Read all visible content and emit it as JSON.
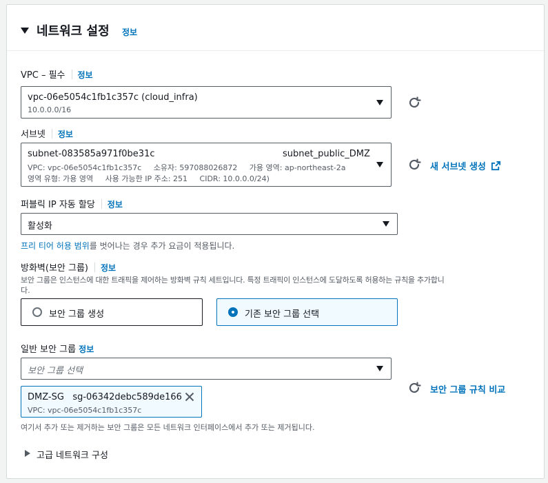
{
  "header": {
    "title": "네트워크 설정",
    "info": "정보"
  },
  "vpc": {
    "label": "VPC – 필수",
    "info": "정보",
    "value": "vpc-06e5054c1fb1c357c (cloud_infra)",
    "sub": "10.0.0.0/16"
  },
  "subnet": {
    "label": "서브넷",
    "info": "정보",
    "value": "subnet-083585a971f0be31c",
    "name": "subnet_public_DMZ",
    "line2": "VPC: vpc-06e5054c1fb1c357c     소유자: 597088026872     가용 영역: ap-northeast-2a",
    "line3": "영역 유형: 가용 영역     사용 가능한 IP 주소: 251     CIDR: 10.0.0.0/24)",
    "create_link": "새 서브넷 생성"
  },
  "public_ip": {
    "label": "퍼블릭 IP 자동 할당",
    "info": "정보",
    "value": "활성화",
    "note_link": "프리 티어 허용 범위",
    "note_rest": "를 벗어나는 경우 추가 요금이 적용됩니다."
  },
  "firewall": {
    "label": "방화벽(보안 그룹)",
    "info": "정보",
    "desc1": "보안 그룹은 인스턴스에 대한 트래픽을 제어하는 방화벽 규칙 세트입니다. 특정 트래픽이 인스턴스에 도달하도록 허용하는 규칙을 추가합니",
    "desc2": "다.",
    "option_create": "보안 그룹 생성",
    "option_existing": "기존 보안 그룹 선택",
    "selected": "option_existing"
  },
  "security_group": {
    "label": "일반 보안 그룹",
    "info": "정보",
    "placeholder": "보안 그룹 선택",
    "compare_link": "보안 그룹 규칙 비교",
    "token_name": "DMZ-SG",
    "token_id": "sg-06342debc589de166",
    "token_sub": "VPC: vpc-06e5054c1fb1c357c",
    "note": "여기서 추가 또는 제거하는 보안 그룹은 모든 네트워크 인터페이스에서 추가 또는 제거됩니다."
  },
  "advanced": {
    "label": "고급 네트워크 구성"
  },
  "colors": {
    "link": "#0073bb",
    "border": "#545b64",
    "selected_bg": "#f1faff"
  },
  "icons": [
    "caret-down-icon",
    "refresh-icon",
    "external-link-icon",
    "close-icon",
    "caret-right-icon"
  ]
}
